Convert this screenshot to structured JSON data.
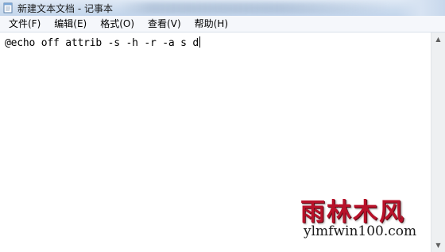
{
  "window": {
    "title": "新建文本文档 - 记事本",
    "icon": "notepad-icon"
  },
  "menu": {
    "items": [
      {
        "label": "文件(F)"
      },
      {
        "label": "编辑(E)"
      },
      {
        "label": "格式(O)"
      },
      {
        "label": "查看(V)"
      },
      {
        "label": "帮助(H)"
      }
    ]
  },
  "editor": {
    "content": "@echo off attrib -s -h -r -a s d"
  },
  "watermark": {
    "chinese": "雨林木风",
    "site": "ylmfwin100.com",
    "color": "#b8122a"
  }
}
